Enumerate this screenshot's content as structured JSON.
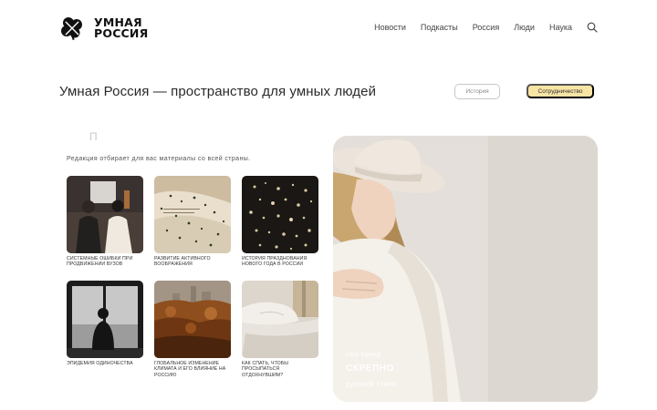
{
  "brand": {
    "line1": "УМНАЯ",
    "line2": "РОССИЯ"
  },
  "nav": {
    "items": [
      "Новости",
      "Подкасты",
      "Россия",
      "Люди",
      "Наука"
    ],
    "search_icon": "search-icon"
  },
  "hero": {
    "title": "Умная Россия — пространство для умных людей",
    "history_button": "История",
    "coop_button": "Сотрудничество"
  },
  "section": {
    "placeholder": "П",
    "subtitle": "Редакция отбирает для вас материалы со всей страны."
  },
  "articles": [
    {
      "caption": "СИСТЕМНЫЕ ОШИБКИ ПРИ ПРОДВИЖЕНИИ ВУЗОВ"
    },
    {
      "caption": "РАЗВИТИЕ АКТИВНОГО ВООБРАЖЕНИЯ"
    },
    {
      "caption": "ИСТОРИЯ ПРАЗДНОВАНИЯ НОВОГО ГОДА В РОССИИ"
    },
    {
      "caption": "ЭПИДЕМИЯ ОДИНОЧЕСТВА"
    },
    {
      "caption": "ГЛОБАЛЬНОЕ ИЗМЕНЕНИЕ КЛИМАТА И ЕГО ВЛИЯНИЕ НА РОССИЮ"
    },
    {
      "caption": "КАК СПАТЬ, ЧТОБЫ ПРОСЫПАТЬСЯ ОТДОХНУВШИМ?"
    }
  ],
  "feature": {
    "kicker": "наш бренд",
    "brand": "СКРЕПНО",
    "style": "русский стиль"
  },
  "colors": {
    "accent_button": "#f8e4a4",
    "feature_bg": "#e4dfda"
  }
}
